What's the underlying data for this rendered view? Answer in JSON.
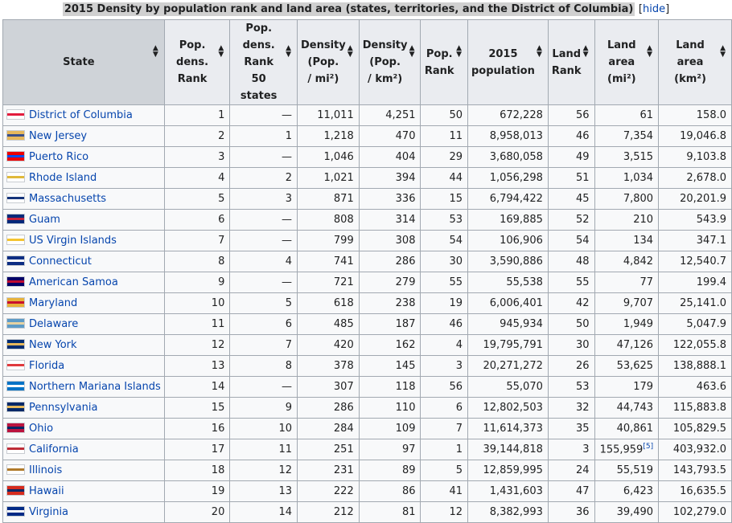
{
  "caption": {
    "title": "2015 Density by population rank and land area (states, territories, and the District of Columbia)",
    "hide_open": "[",
    "hide_label": "hide",
    "hide_close": "]"
  },
  "headers": [
    {
      "lines": [
        "State"
      ]
    },
    {
      "lines": [
        "Pop. dens.",
        "Rank"
      ]
    },
    {
      "lines": [
        "Pop. dens.",
        "Rank",
        "50 states"
      ]
    },
    {
      "lines": [
        "Density",
        "(Pop.",
        "/ mi²)"
      ]
    },
    {
      "lines": [
        "Density",
        "(Pop.",
        "/ km²)"
      ]
    },
    {
      "lines": [
        "Pop.",
        "Rank"
      ]
    },
    {
      "lines": [
        "2015",
        "population"
      ]
    },
    {
      "lines": [
        "Land",
        "Rank"
      ]
    },
    {
      "lines": [
        "Land",
        "area",
        "(mi²)"
      ]
    },
    {
      "lines": [
        "Land",
        "area",
        "(km²)"
      ]
    }
  ],
  "colors": {
    "link": "#0645ad",
    "header_bg": "#eaecf0",
    "border": "#a2a9b1"
  },
  "rows": [
    {
      "state": "District of Columbia",
      "flag": "dc-flag-icon",
      "flag_colors": [
        "#ffffff",
        "#e31c3d"
      ],
      "rank": "1",
      "rank50": "—",
      "dens_mi": "11,011",
      "dens_km": "4,251",
      "pop_rank": "50",
      "population": "672,228",
      "land_rank": "56",
      "area_mi": "61",
      "area_ref": "",
      "area_km": "158.0"
    },
    {
      "state": "New Jersey",
      "flag": "new-jersey-flag-icon",
      "flag_colors": [
        "#e6b85c",
        "#3a4f8a"
      ],
      "rank": "2",
      "rank50": "1",
      "dens_mi": "1,218",
      "dens_km": "470",
      "pop_rank": "11",
      "population": "8,958,013",
      "land_rank": "46",
      "area_mi": "7,354",
      "area_ref": "",
      "area_km": "19,046.8"
    },
    {
      "state": "Puerto Rico",
      "flag": "puerto-rico-flag-icon",
      "flag_colors": [
        "#ed0000",
        "#0050f0"
      ],
      "rank": "3",
      "rank50": "—",
      "dens_mi": "1,046",
      "dens_km": "404",
      "pop_rank": "29",
      "population": "3,680,058",
      "land_rank": "49",
      "area_mi": "3,515",
      "area_ref": "",
      "area_km": "9,103.8"
    },
    {
      "state": "Rhode Island",
      "flag": "rhode-island-flag-icon",
      "flag_colors": [
        "#ffffff",
        "#e0b93a"
      ],
      "rank": "4",
      "rank50": "2",
      "dens_mi": "1,021",
      "dens_km": "394",
      "pop_rank": "44",
      "population": "1,056,298",
      "land_rank": "51",
      "area_mi": "1,034",
      "area_ref": "",
      "area_km": "2,678.0"
    },
    {
      "state": "Massachusetts",
      "flag": "massachusetts-flag-icon",
      "flag_colors": [
        "#ffffff",
        "#14337a"
      ],
      "rank": "5",
      "rank50": "3",
      "dens_mi": "871",
      "dens_km": "336",
      "pop_rank": "15",
      "population": "6,794,422",
      "land_rank": "45",
      "area_mi": "7,800",
      "area_ref": "",
      "area_km": "20,201.9"
    },
    {
      "state": "Guam",
      "flag": "guam-flag-icon",
      "flag_colors": [
        "#00297b",
        "#c62139"
      ],
      "rank": "6",
      "rank50": "—",
      "dens_mi": "808",
      "dens_km": "314",
      "pop_rank": "53",
      "population": "169,885",
      "land_rank": "52",
      "area_mi": "210",
      "area_ref": "",
      "area_km": "543.9"
    },
    {
      "state": "US Virgin Islands",
      "flag": "us-virgin-islands-flag-icon",
      "flag_colors": [
        "#ffffff",
        "#f4c430"
      ],
      "rank": "7",
      "rank50": "—",
      "dens_mi": "799",
      "dens_km": "308",
      "pop_rank": "54",
      "population": "106,906",
      "land_rank": "54",
      "area_mi": "134",
      "area_ref": "",
      "area_km": "347.1"
    },
    {
      "state": "Connecticut",
      "flag": "connecticut-flag-icon",
      "flag_colors": [
        "#0c2d83",
        "#ffffff"
      ],
      "rank": "8",
      "rank50": "4",
      "dens_mi": "741",
      "dens_km": "286",
      "pop_rank": "30",
      "population": "3,590,886",
      "land_rank": "48",
      "area_mi": "4,842",
      "area_ref": "",
      "area_km": "12,540.7"
    },
    {
      "state": "American Samoa",
      "flag": "american-samoa-flag-icon",
      "flag_colors": [
        "#000066",
        "#bf0a30"
      ],
      "rank": "9",
      "rank50": "—",
      "dens_mi": "721",
      "dens_km": "279",
      "pop_rank": "55",
      "population": "55,538",
      "land_rank": "55",
      "area_mi": "77",
      "area_ref": "",
      "area_km": "199.4"
    },
    {
      "state": "Maryland",
      "flag": "maryland-flag-icon",
      "flag_colors": [
        "#e8b23a",
        "#c8102e"
      ],
      "rank": "10",
      "rank50": "5",
      "dens_mi": "618",
      "dens_km": "238",
      "pop_rank": "19",
      "population": "6,006,401",
      "land_rank": "42",
      "area_mi": "9,707",
      "area_ref": "",
      "area_km": "25,141.0"
    },
    {
      "state": "Delaware",
      "flag": "delaware-flag-icon",
      "flag_colors": [
        "#5d9bc7",
        "#e5d2a2"
      ],
      "rank": "11",
      "rank50": "6",
      "dens_mi": "485",
      "dens_km": "187",
      "pop_rank": "46",
      "population": "945,934",
      "land_rank": "50",
      "area_mi": "1,949",
      "area_ref": "",
      "area_km": "5,047.9"
    },
    {
      "state": "New York",
      "flag": "new-york-flag-icon",
      "flag_colors": [
        "#002d72",
        "#e6b85c"
      ],
      "rank": "12",
      "rank50": "7",
      "dens_mi": "420",
      "dens_km": "162",
      "pop_rank": "4",
      "population": "19,795,791",
      "land_rank": "30",
      "area_mi": "47,126",
      "area_ref": "",
      "area_km": "122,055.8"
    },
    {
      "state": "Florida",
      "flag": "florida-flag-icon",
      "flag_colors": [
        "#ffffff",
        "#e03a3e"
      ],
      "rank": "13",
      "rank50": "8",
      "dens_mi": "378",
      "dens_km": "145",
      "pop_rank": "3",
      "population": "20,271,272",
      "land_rank": "26",
      "area_mi": "53,625",
      "area_ref": "",
      "area_km": "138,888.1"
    },
    {
      "state": "Northern Mariana Islands",
      "flag": "northern-mariana-islands-flag-icon",
      "flag_colors": [
        "#0072c6",
        "#ffffff"
      ],
      "rank": "14",
      "rank50": "—",
      "dens_mi": "307",
      "dens_km": "118",
      "pop_rank": "56",
      "population": "55,070",
      "land_rank": "53",
      "area_mi": "179",
      "area_ref": "",
      "area_km": "463.6"
    },
    {
      "state": "Pennsylvania",
      "flag": "pennsylvania-flag-icon",
      "flag_colors": [
        "#002868",
        "#e6b85c"
      ],
      "rank": "15",
      "rank50": "9",
      "dens_mi": "286",
      "dens_km": "110",
      "pop_rank": "6",
      "population": "12,802,503",
      "land_rank": "32",
      "area_mi": "44,743",
      "area_ref": "",
      "area_km": "115,883.8"
    },
    {
      "state": "Ohio",
      "flag": "ohio-flag-icon",
      "flag_colors": [
        "#bb133e",
        "#002664"
      ],
      "rank": "16",
      "rank50": "10",
      "dens_mi": "284",
      "dens_km": "109",
      "pop_rank": "7",
      "population": "11,614,373",
      "land_rank": "35",
      "area_mi": "40,861",
      "area_ref": "",
      "area_km": "105,829.5"
    },
    {
      "state": "California",
      "flag": "california-flag-icon",
      "flag_colors": [
        "#ffffff",
        "#be2c37"
      ],
      "rank": "17",
      "rank50": "11",
      "dens_mi": "251",
      "dens_km": "97",
      "pop_rank": "1",
      "population": "39,144,818",
      "land_rank": "3",
      "area_mi": "155,959",
      "area_ref": "[5]",
      "area_km": "403,932.0"
    },
    {
      "state": "Illinois",
      "flag": "illinois-flag-icon",
      "flag_colors": [
        "#ffffff",
        "#b07a2a"
      ],
      "rank": "18",
      "rank50": "12",
      "dens_mi": "231",
      "dens_km": "89",
      "pop_rank": "5",
      "population": "12,859,995",
      "land_rank": "24",
      "area_mi": "55,519",
      "area_ref": "",
      "area_km": "143,793.5"
    },
    {
      "state": "Hawaii",
      "flag": "hawaii-flag-icon",
      "flag_colors": [
        "#d52b1e",
        "#002868"
      ],
      "rank": "19",
      "rank50": "13",
      "dens_mi": "222",
      "dens_km": "86",
      "pop_rank": "41",
      "population": "1,431,603",
      "land_rank": "47",
      "area_mi": "6,423",
      "area_ref": "",
      "area_km": "16,635.5"
    },
    {
      "state": "Virginia",
      "flag": "virginia-flag-icon",
      "flag_colors": [
        "#002a86",
        "#ffffff"
      ],
      "rank": "20",
      "rank50": "14",
      "dens_mi": "212",
      "dens_km": "81",
      "pop_rank": "12",
      "population": "8,382,993",
      "land_rank": "36",
      "area_mi": "39,490",
      "area_ref": "",
      "area_km": "102,279.0"
    }
  ]
}
